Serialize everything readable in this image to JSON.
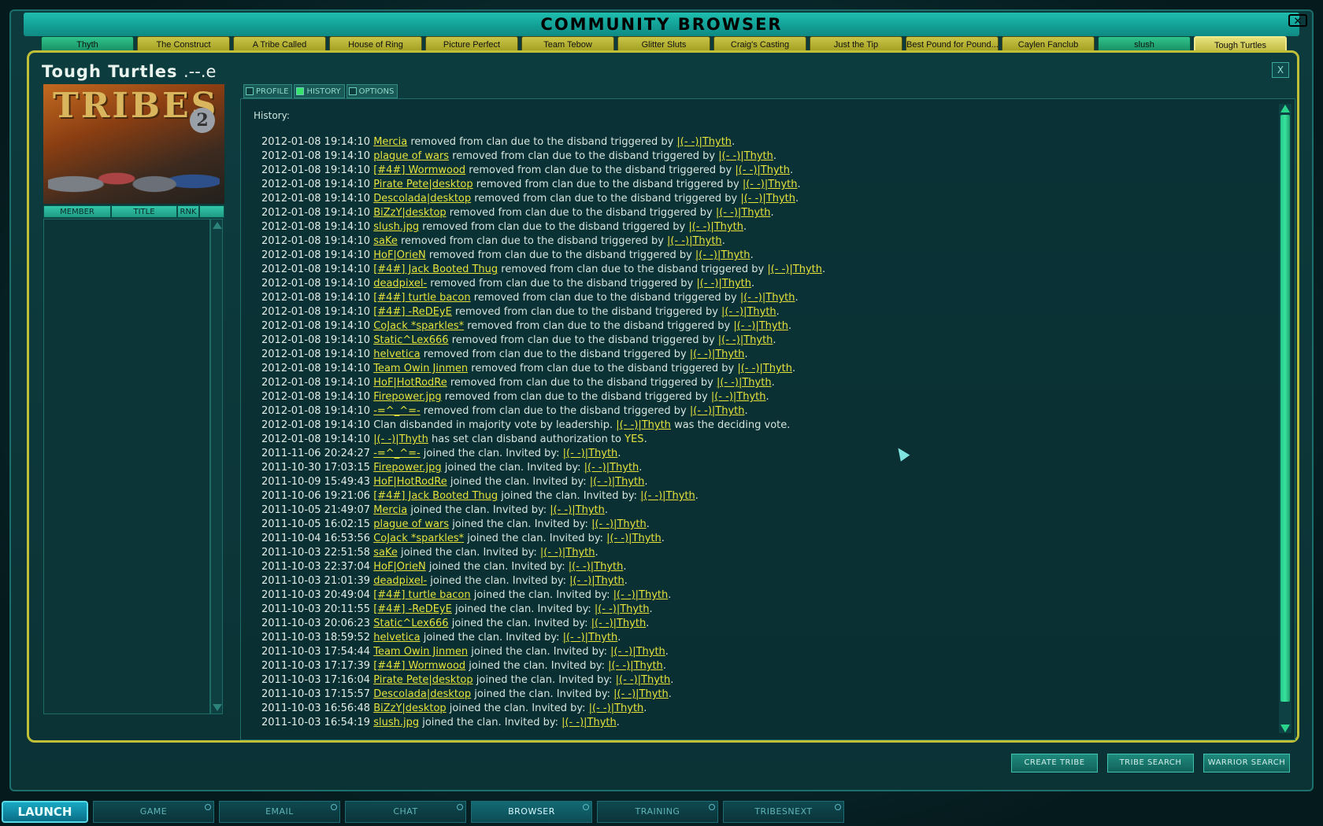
{
  "window": {
    "title": "COMMUNITY BROWSER"
  },
  "tabs": [
    {
      "label": "Thyth",
      "style": "green"
    },
    {
      "label": "The Construct",
      "style": "yellow"
    },
    {
      "label": "A Tribe Called",
      "style": "yellow"
    },
    {
      "label": "House of Ring",
      "style": "yellow"
    },
    {
      "label": "Picture Perfect",
      "style": "yellow"
    },
    {
      "label": "Team Tebow",
      "style": "yellow"
    },
    {
      "label": "Glitter Sluts",
      "style": "yellow"
    },
    {
      "label": "Craig's Casting",
      "style": "yellow"
    },
    {
      "label": "Just the Tip",
      "style": "yellow"
    },
    {
      "label": "Best Pound for Pound...",
      "style": "yellow"
    },
    {
      "label": "Caylen Fanclub",
      "style": "yellow"
    },
    {
      "label": "slush",
      "style": "green"
    },
    {
      "label": "Tough Turtles",
      "style": "active"
    }
  ],
  "tribe": {
    "name": "Tough Turtles",
    "tag": ".--.e",
    "logo_text": "TRIBES",
    "logo_number": "2",
    "close_label": "X"
  },
  "member_columns": {
    "member": "MEMBER",
    "title": "TITLE",
    "rank": "RNK"
  },
  "subtabs": [
    {
      "label": "PROFILE",
      "active": false
    },
    {
      "label": "HISTORY",
      "active": true
    },
    {
      "label": "OPTIONS",
      "active": false
    }
  ],
  "history": {
    "label": "History:",
    "rows": [
      {
        "ts": "2012-01-08 19:14:10",
        "parts": [
          {
            "t": "Mercia",
            "l": true
          },
          {
            "t": " removed from clan due to the disband triggered by "
          },
          {
            "t": "|(- -)|Thyth",
            "l": true
          },
          {
            "t": "."
          }
        ]
      },
      {
        "ts": "2012-01-08 19:14:10",
        "parts": [
          {
            "t": "plague of wars",
            "l": true
          },
          {
            "t": " removed from clan due to the disband triggered by "
          },
          {
            "t": "|(- -)|Thyth",
            "l": true
          },
          {
            "t": "."
          }
        ]
      },
      {
        "ts": "2012-01-08 19:14:10",
        "parts": [
          {
            "t": "[#4#] Wormwood",
            "l": true
          },
          {
            "t": " removed from clan due to the disband triggered by "
          },
          {
            "t": "|(- -)|Thyth",
            "l": true
          },
          {
            "t": "."
          }
        ]
      },
      {
        "ts": "2012-01-08 19:14:10",
        "parts": [
          {
            "t": "Pirate Pete|desktop",
            "l": true
          },
          {
            "t": " removed from clan due to the disband triggered by "
          },
          {
            "t": "|(- -)|Thyth",
            "l": true
          },
          {
            "t": "."
          }
        ]
      },
      {
        "ts": "2012-01-08 19:14:10",
        "parts": [
          {
            "t": "Descolada|desktop",
            "l": true
          },
          {
            "t": " removed from clan due to the disband triggered by "
          },
          {
            "t": "|(- -)|Thyth",
            "l": true
          },
          {
            "t": "."
          }
        ]
      },
      {
        "ts": "2012-01-08 19:14:10",
        "parts": [
          {
            "t": "BiZzY|desktop",
            "l": true
          },
          {
            "t": " removed from clan due to the disband triggered by "
          },
          {
            "t": "|(- -)|Thyth",
            "l": true
          },
          {
            "t": "."
          }
        ]
      },
      {
        "ts": "2012-01-08 19:14:10",
        "parts": [
          {
            "t": "slush.jpg",
            "l": true
          },
          {
            "t": " removed from clan due to the disband triggered by "
          },
          {
            "t": "|(- -)|Thyth",
            "l": true
          },
          {
            "t": "."
          }
        ]
      },
      {
        "ts": "2012-01-08 19:14:10",
        "parts": [
          {
            "t": "saKe",
            "l": true
          },
          {
            "t": " removed from clan due to the disband triggered by "
          },
          {
            "t": "|(- -)|Thyth",
            "l": true
          },
          {
            "t": "."
          }
        ]
      },
      {
        "ts": "2012-01-08 19:14:10",
        "parts": [
          {
            "t": "HoF|OrieN",
            "l": true
          },
          {
            "t": " removed from clan due to the disband triggered by "
          },
          {
            "t": "|(- -)|Thyth",
            "l": true
          },
          {
            "t": "."
          }
        ]
      },
      {
        "ts": "2012-01-08 19:14:10",
        "parts": [
          {
            "t": "[#4#] Jack Booted Thug",
            "l": true
          },
          {
            "t": " removed from clan due to the disband triggered by "
          },
          {
            "t": "|(- -)|Thyth",
            "l": true
          },
          {
            "t": "."
          }
        ]
      },
      {
        "ts": "2012-01-08 19:14:10",
        "parts": [
          {
            "t": "deadpixel-",
            "l": true
          },
          {
            "t": " removed from clan due to the disband triggered by "
          },
          {
            "t": "|(- -)|Thyth",
            "l": true
          },
          {
            "t": "."
          }
        ]
      },
      {
        "ts": "2012-01-08 19:14:10",
        "parts": [
          {
            "t": "[#4#] turtle bacon",
            "l": true
          },
          {
            "t": " removed from clan due to the disband triggered by "
          },
          {
            "t": "|(- -)|Thyth",
            "l": true
          },
          {
            "t": "."
          }
        ]
      },
      {
        "ts": "2012-01-08 19:14:10",
        "parts": [
          {
            "t": "[#4#] -ReDEyE",
            "l": true
          },
          {
            "t": " removed from clan due to the disband triggered by "
          },
          {
            "t": "|(- -)|Thyth",
            "l": true
          },
          {
            "t": "."
          }
        ]
      },
      {
        "ts": "2012-01-08 19:14:10",
        "parts": [
          {
            "t": "CoJack *sparkles*",
            "l": true
          },
          {
            "t": " removed from clan due to the disband triggered by "
          },
          {
            "t": "|(- -)|Thyth",
            "l": true
          },
          {
            "t": "."
          }
        ]
      },
      {
        "ts": "2012-01-08 19:14:10",
        "parts": [
          {
            "t": "Static^Lex666",
            "l": true
          },
          {
            "t": " removed from clan due to the disband triggered by "
          },
          {
            "t": "|(- -)|Thyth",
            "l": true
          },
          {
            "t": "."
          }
        ]
      },
      {
        "ts": "2012-01-08 19:14:10",
        "parts": [
          {
            "t": "helvetica",
            "l": true
          },
          {
            "t": " removed from clan due to the disband triggered by "
          },
          {
            "t": "|(- -)|Thyth",
            "l": true
          },
          {
            "t": "."
          }
        ]
      },
      {
        "ts": "2012-01-08 19:14:10",
        "parts": [
          {
            "t": "Team Owin Jinmen",
            "l": true
          },
          {
            "t": " removed from clan due to the disband triggered by "
          },
          {
            "t": "|(- -)|Thyth",
            "l": true
          },
          {
            "t": "."
          }
        ]
      },
      {
        "ts": "2012-01-08 19:14:10",
        "parts": [
          {
            "t": "HoF|HotRodRe",
            "l": true
          },
          {
            "t": " removed from clan due to the disband triggered by "
          },
          {
            "t": "|(- -)|Thyth",
            "l": true
          },
          {
            "t": "."
          }
        ]
      },
      {
        "ts": "2012-01-08 19:14:10",
        "parts": [
          {
            "t": "Firepower.jpg",
            "l": true
          },
          {
            "t": " removed from clan due to the disband triggered by "
          },
          {
            "t": "|(- -)|Thyth",
            "l": true
          },
          {
            "t": "."
          }
        ]
      },
      {
        "ts": "2012-01-08 19:14:10",
        "parts": [
          {
            "t": "-=^_^=-",
            "l": true
          },
          {
            "t": " removed from clan due to the disband triggered by "
          },
          {
            "t": "|(- -)|Thyth",
            "l": true
          },
          {
            "t": "."
          }
        ]
      },
      {
        "ts": "2012-01-08 19:14:10",
        "parts": [
          {
            "t": "Clan disbanded in majority vote by leadership. "
          },
          {
            "t": "|(- -)|Thyth",
            "l": true
          },
          {
            "t": " was the deciding vote."
          }
        ]
      },
      {
        "ts": "2012-01-08 19:14:10",
        "parts": [
          {
            "t": "|(- -)|Thyth",
            "l": true
          },
          {
            "t": " has set clan disband authorization to "
          },
          {
            "t": "YES",
            "y": true
          },
          {
            "t": "."
          }
        ]
      },
      {
        "ts": "2011-11-06 20:24:27",
        "parts": [
          {
            "t": "-=^_^=-",
            "l": true
          },
          {
            "t": " joined the clan. Invited by: "
          },
          {
            "t": "|(- -)|Thyth",
            "l": true
          },
          {
            "t": "."
          }
        ]
      },
      {
        "ts": "2011-10-30 17:03:15",
        "parts": [
          {
            "t": "Firepower.jpg",
            "l": true
          },
          {
            "t": " joined the clan. Invited by: "
          },
          {
            "t": "|(- -)|Thyth",
            "l": true
          },
          {
            "t": "."
          }
        ]
      },
      {
        "ts": "2011-10-09 15:49:43",
        "parts": [
          {
            "t": "HoF|HotRodRe",
            "l": true
          },
          {
            "t": " joined the clan. Invited by: "
          },
          {
            "t": "|(- -)|Thyth",
            "l": true
          },
          {
            "t": "."
          }
        ]
      },
      {
        "ts": "2011-10-06 19:21:06",
        "parts": [
          {
            "t": "[#4#] Jack Booted Thug",
            "l": true
          },
          {
            "t": " joined the clan. Invited by: "
          },
          {
            "t": "|(- -)|Thyth",
            "l": true
          },
          {
            "t": "."
          }
        ]
      },
      {
        "ts": "2011-10-05 21:49:07",
        "parts": [
          {
            "t": "Mercia",
            "l": true
          },
          {
            "t": " joined the clan. Invited by: "
          },
          {
            "t": "|(- -)|Thyth",
            "l": true
          },
          {
            "t": "."
          }
        ]
      },
      {
        "ts": "2011-10-05 16:02:15",
        "parts": [
          {
            "t": "plague of wars",
            "l": true
          },
          {
            "t": " joined the clan. Invited by: "
          },
          {
            "t": "|(- -)|Thyth",
            "l": true
          },
          {
            "t": "."
          }
        ]
      },
      {
        "ts": "2011-10-04 16:53:56",
        "parts": [
          {
            "t": "CoJack *sparkles*",
            "l": true
          },
          {
            "t": " joined the clan. Invited by: "
          },
          {
            "t": "|(- -)|Thyth",
            "l": true
          },
          {
            "t": "."
          }
        ]
      },
      {
        "ts": "2011-10-03 22:51:58",
        "parts": [
          {
            "t": "saKe",
            "l": true
          },
          {
            "t": " joined the clan. Invited by: "
          },
          {
            "t": "|(- -)|Thyth",
            "l": true
          },
          {
            "t": "."
          }
        ]
      },
      {
        "ts": "2011-10-03 22:37:04",
        "parts": [
          {
            "t": "HoF|OrieN",
            "l": true
          },
          {
            "t": " joined the clan. Invited by: "
          },
          {
            "t": "|(- -)|Thyth",
            "l": true
          },
          {
            "t": "."
          }
        ]
      },
      {
        "ts": "2011-10-03 21:01:39",
        "parts": [
          {
            "t": "deadpixel-",
            "l": true
          },
          {
            "t": " joined the clan. Invited by: "
          },
          {
            "t": "|(- -)|Thyth",
            "l": true
          },
          {
            "t": "."
          }
        ]
      },
      {
        "ts": "2011-10-03 20:49:04",
        "parts": [
          {
            "t": "[#4#] turtle bacon",
            "l": true
          },
          {
            "t": " joined the clan. Invited by: "
          },
          {
            "t": "|(- -)|Thyth",
            "l": true
          },
          {
            "t": "."
          }
        ]
      },
      {
        "ts": "2011-10-03 20:11:55",
        "parts": [
          {
            "t": "[#4#] -ReDEyE",
            "l": true
          },
          {
            "t": " joined the clan. Invited by: "
          },
          {
            "t": "|(- -)|Thyth",
            "l": true
          },
          {
            "t": "."
          }
        ]
      },
      {
        "ts": "2011-10-03 20:06:23",
        "parts": [
          {
            "t": "Static^Lex666",
            "l": true
          },
          {
            "t": " joined the clan. Invited by: "
          },
          {
            "t": "|(- -)|Thyth",
            "l": true
          },
          {
            "t": "."
          }
        ]
      },
      {
        "ts": "2011-10-03 18:59:52",
        "parts": [
          {
            "t": "helvetica",
            "l": true
          },
          {
            "t": " joined the clan. Invited by: "
          },
          {
            "t": "|(- -)|Thyth",
            "l": true
          },
          {
            "t": "."
          }
        ]
      },
      {
        "ts": "2011-10-03 17:54:44",
        "parts": [
          {
            "t": "Team Owin Jinmen",
            "l": true
          },
          {
            "t": " joined the clan. Invited by: "
          },
          {
            "t": "|(- -)|Thyth",
            "l": true
          },
          {
            "t": "."
          }
        ]
      },
      {
        "ts": "2011-10-03 17:17:39",
        "parts": [
          {
            "t": "[#4#] Wormwood",
            "l": true
          },
          {
            "t": " joined the clan. Invited by: "
          },
          {
            "t": "|(- -)|Thyth",
            "l": true
          },
          {
            "t": "."
          }
        ]
      },
      {
        "ts": "2011-10-03 17:16:04",
        "parts": [
          {
            "t": "Pirate Pete|desktop",
            "l": true
          },
          {
            "t": " joined the clan. Invited by: "
          },
          {
            "t": "|(- -)|Thyth",
            "l": true
          },
          {
            "t": "."
          }
        ]
      },
      {
        "ts": "2011-10-03 17:15:57",
        "parts": [
          {
            "t": "Descolada|desktop",
            "l": true
          },
          {
            "t": " joined the clan. Invited by: "
          },
          {
            "t": "|(- -)|Thyth",
            "l": true
          },
          {
            "t": "."
          }
        ]
      },
      {
        "ts": "2011-10-03 16:56:48",
        "parts": [
          {
            "t": "BiZzY|desktop",
            "l": true
          },
          {
            "t": " joined the clan. Invited by: "
          },
          {
            "t": "|(- -)|Thyth",
            "l": true
          },
          {
            "t": "."
          }
        ]
      },
      {
        "ts": "2011-10-03 16:54:19",
        "parts": [
          {
            "t": "slush.jpg",
            "l": true
          },
          {
            "t": " joined the clan. Invited by: "
          },
          {
            "t": "|(- -)|Thyth",
            "l": true
          },
          {
            "t": "."
          }
        ]
      }
    ]
  },
  "buttons": {
    "create_tribe": "CREATE TRIBE",
    "tribe_search": "TRIBE SEARCH",
    "warrior_search": "WARRIOR SEARCH"
  },
  "launchbar": {
    "launch": "LAUNCH",
    "items": [
      {
        "label": "GAME",
        "active": false
      },
      {
        "label": "EMAIL",
        "active": false
      },
      {
        "label": "CHAT",
        "active": false
      },
      {
        "label": "BROWSER",
        "active": true
      },
      {
        "label": "TRAINING",
        "active": false
      },
      {
        "label": "TRIBESNEXT",
        "active": false
      }
    ]
  },
  "colors": {
    "accent": "#bfbf38",
    "link": "#e5e23c",
    "title_bar": "#13a097"
  }
}
